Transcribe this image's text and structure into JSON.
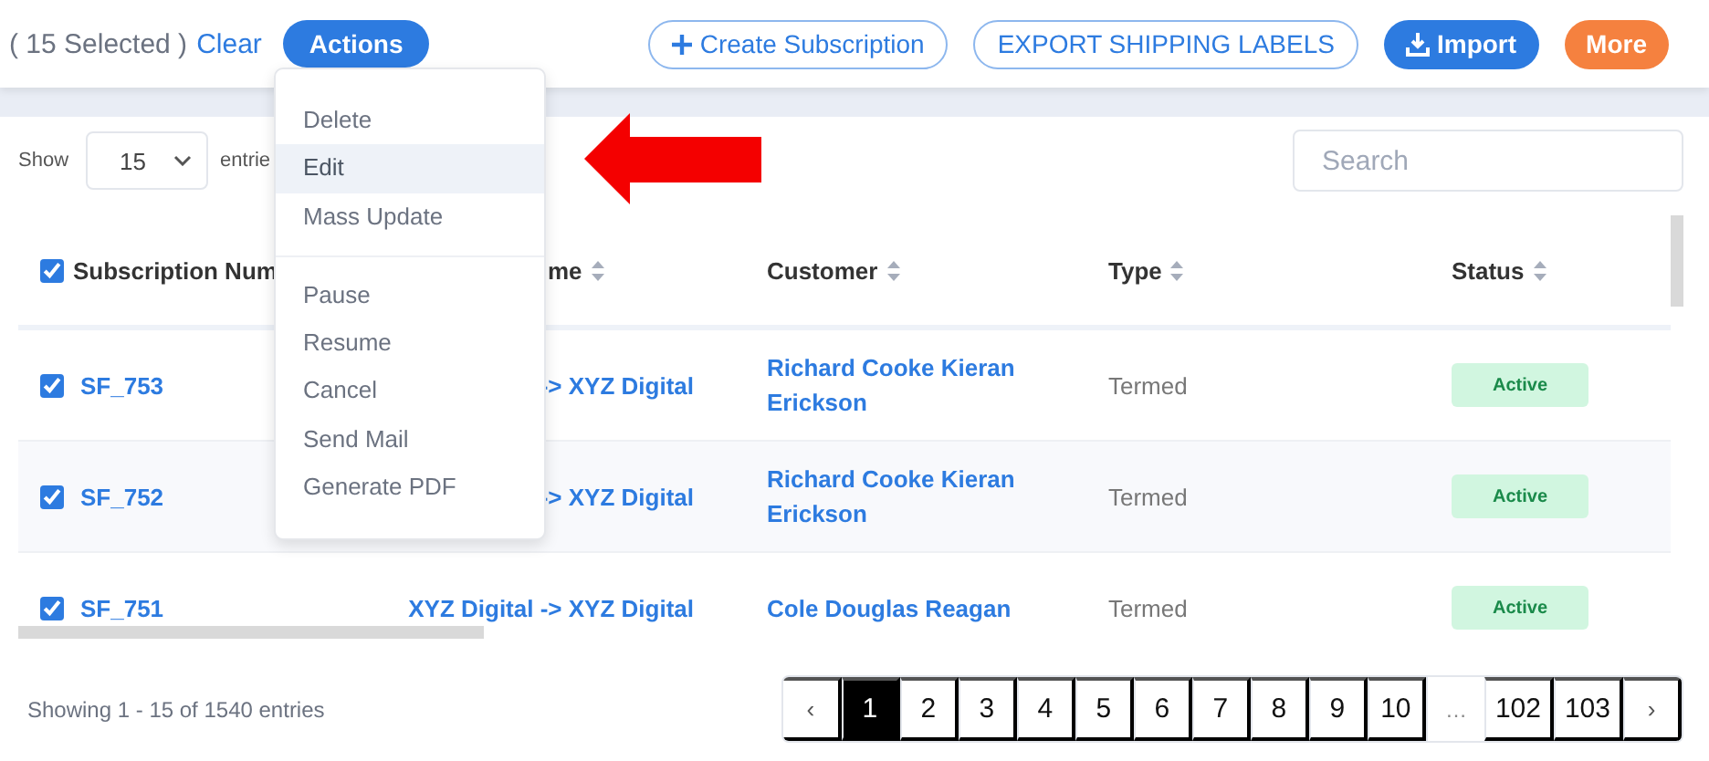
{
  "toolbar": {
    "selection_count": "( 15 Selected )",
    "clear_link": "Clear",
    "actions_button": "Actions",
    "buttons": [
      {
        "label": "Create Subscription",
        "kind": "add"
      },
      {
        "label": "EXPORT SHIPPING LABELS",
        "kind": "plain"
      },
      {
        "label": "Import",
        "kind": "download",
        "color": "#2d7be0"
      },
      {
        "label": "More",
        "kind": "accent",
        "color": "#f5813f"
      }
    ]
  },
  "actions_menu": {
    "groups": [
      [
        {
          "label": "Delete",
          "selected": false
        },
        {
          "label": "Edit",
          "selected": true
        },
        {
          "label": "Mass Update",
          "selected": false
        }
      ],
      [
        {
          "label": "Pause",
          "selected": false
        },
        {
          "label": "Resume",
          "selected": false
        },
        {
          "label": "Cancel",
          "selected": false
        },
        {
          "label": "Send Mail",
          "selected": false
        },
        {
          "label": "Generate PDF",
          "selected": false
        }
      ]
    ]
  },
  "entries_control": {
    "label": "Show",
    "value": "15",
    "suffix": "entrie"
  },
  "search": {
    "placeholder": "Search"
  },
  "table": {
    "select_all_checked": true,
    "columns": [
      {
        "label": "Subscription Num"
      },
      {
        "label": "me",
        "sortable": true
      },
      {
        "label": "Customer",
        "sortable": true
      },
      {
        "label": "Type",
        "sortable": true
      },
      {
        "label": "Status",
        "sortable": true
      }
    ],
    "rows": [
      {
        "checked": true,
        "subscription": "SF_753",
        "plan": "-> XYZ Digital",
        "customer": "Richard Cooke Kieran Erickson",
        "type": "Termed",
        "status": "Active"
      },
      {
        "checked": true,
        "subscription": "SF_752",
        "plan": "-> XYZ Digital",
        "customer": "Richard Cooke Kieran Erickson",
        "type": "Termed",
        "status": "Active"
      },
      {
        "checked": true,
        "subscription": "SF_751",
        "plan": "XYZ Digital -> XYZ Digital",
        "customer": "Cole Douglas Reagan",
        "type": "Termed",
        "status": "Active"
      }
    ]
  },
  "footer": {
    "summary": "Showing 1 - 15 of 1540 entries",
    "pagination": [
      {
        "label": "‹",
        "kind": "arrow",
        "selected": false
      },
      {
        "label": "1",
        "kind": "page",
        "selected": true
      },
      {
        "label": "2",
        "kind": "page",
        "selected": false
      },
      {
        "label": "3",
        "kind": "page",
        "selected": false
      },
      {
        "label": "4",
        "kind": "page",
        "selected": false
      },
      {
        "label": "5",
        "kind": "page",
        "selected": false
      },
      {
        "label": "6",
        "kind": "page",
        "selected": false
      },
      {
        "label": "7",
        "kind": "page",
        "selected": false
      },
      {
        "label": "8",
        "kind": "page",
        "selected": false
      },
      {
        "label": "9",
        "kind": "page",
        "selected": false
      },
      {
        "label": "10",
        "kind": "page",
        "selected": false
      },
      {
        "label": "…",
        "kind": "gap",
        "selected": false
      },
      {
        "label": "102",
        "kind": "page",
        "selected": false
      },
      {
        "label": "103",
        "kind": "page",
        "selected": false
      },
      {
        "label": "›",
        "kind": "arrow",
        "selected": false
      }
    ]
  }
}
